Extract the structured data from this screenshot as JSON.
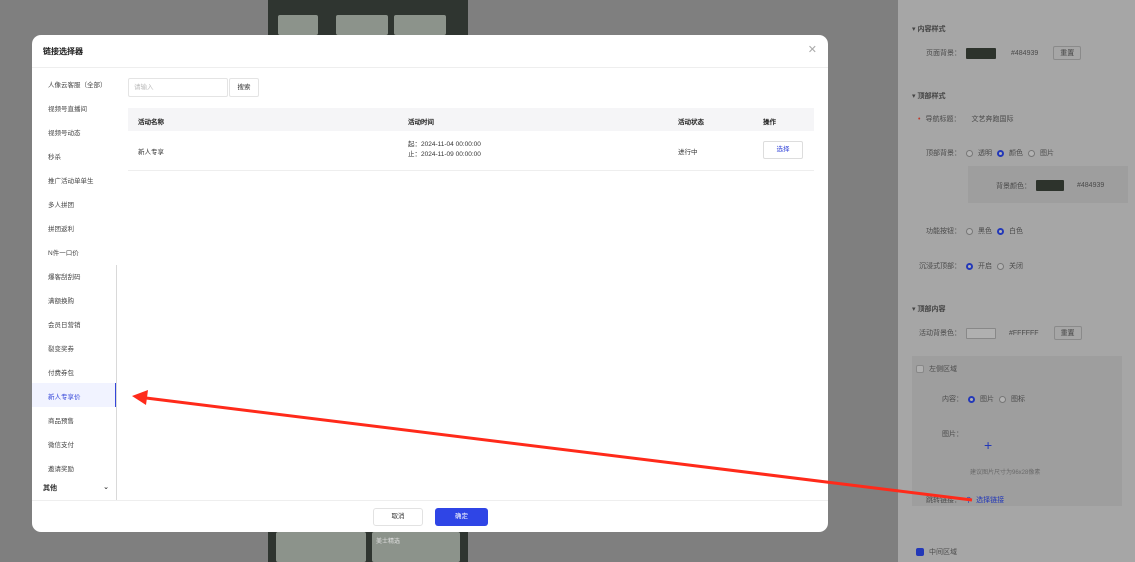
{
  "colors": {
    "accent": "#3446d9",
    "confirm_bg": "#2f45e6",
    "arrow": "#ff2a1a",
    "preview_bg": "#484939",
    "overlay": "#7f7f7f"
  },
  "modal": {
    "title": "链接选择器",
    "close_icon": "close-icon",
    "search_placeholder": "请输入",
    "search_button": "搜索",
    "sidebar": {
      "items": [
        "人像云客服（全部）",
        "视频号直播间",
        "视频号动态",
        "秒杀",
        "推广活动单单生",
        "多人拼团",
        "拼团返利",
        "N件一口价",
        "爆客刮刮码",
        "满额换购",
        "会员日营销",
        "裂变奖券",
        "付费券包",
        "新人专享价",
        "商品预售",
        "微信支付",
        "邀请奖励"
      ],
      "active_index": 13,
      "group_label": "其他",
      "group_icon": "chevron-down-icon"
    },
    "table": {
      "headers": [
        "活动名称",
        "活动时间",
        "活动状态",
        "操作"
      ],
      "rows": [
        {
          "name": "新人专享",
          "time_start": "起：2024-11-04 00:00:00",
          "time_end": "止：2024-11-09 00:00:00",
          "status": "进行中",
          "action": "选择"
        }
      ]
    },
    "footer": {
      "cancel": "取消",
      "confirm": "确定"
    }
  },
  "settings_panel": {
    "content_style": "内容样式",
    "page_bg_label": "页面背景：",
    "page_bg_value": "#484939",
    "reset": "重置",
    "top_style": "顶部样式",
    "nav_title_label": "导航标题：",
    "nav_title_value": "文艺奔跑国际",
    "top_bg_label": "顶部背景：",
    "top_bg_options": [
      "透明",
      "颜色",
      "图片"
    ],
    "top_bg_selected": 1,
    "bg_color_label": "背景颜色：",
    "bg_color_value": "#484939",
    "func_btn_label": "功能按钮：",
    "func_btn_options": [
      "黑色",
      "白色"
    ],
    "func_btn_selected": 1,
    "immersive_label": "沉浸式顶部：",
    "immersive_options": [
      "开启",
      "关闭"
    ],
    "immersive_selected": 0,
    "top_content": "顶部内容",
    "activity_bg_label": "活动背景色：",
    "activity_bg_value": "#FFFFFF",
    "left_area": "左侧区域",
    "content_label": "内容：",
    "content_options": [
      "图片",
      "图标"
    ],
    "content_selected": 0,
    "image_label": "图片：",
    "image_hint": "建议图片尺寸为96x28像素",
    "jump_link_label": "跳转链接：",
    "jump_link_value": "选择链接",
    "middle_area": "中间区域"
  },
  "preview": {
    "caption": "美士精选"
  }
}
